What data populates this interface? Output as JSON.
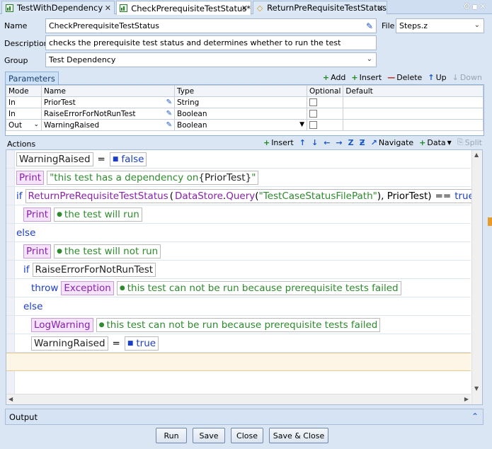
{
  "tabs": [
    {
      "label": "TestWithDependency",
      "icon": "test-icon"
    },
    {
      "label": "CheckPrerequisiteTestStatus*",
      "icon": "test-icon"
    },
    {
      "label": "ReturnPreRequisiteTestStatus",
      "icon": "function-icon"
    }
  ],
  "form": {
    "name_label": "Name",
    "name_value": "CheckPrerequisiteTestStatus",
    "file_label": "File",
    "file_value": "Steps.z",
    "desc_label": "Description",
    "desc_value": "checks the prerequisite test status and determines whether to run the test",
    "group_label": "Group",
    "group_value": "Test Dependency"
  },
  "params": {
    "tab_label": "Parameters",
    "toolbar": {
      "add": "Add",
      "insert": "Insert",
      "delete": "Delete",
      "up": "Up",
      "down": "Down"
    },
    "columns": [
      "Mode",
      "Name",
      "Type",
      "Optional",
      "Default"
    ],
    "rows": [
      {
        "mode": "In",
        "name": "PriorTest",
        "type": "String"
      },
      {
        "mode": "In",
        "name": "RaiseErrorForNotRunTest",
        "type": "Boolean"
      },
      {
        "mode": "Out",
        "name": "WarningRaised",
        "type": "Boolean"
      }
    ]
  },
  "actions": {
    "label": "Actions",
    "toolbar": {
      "insert": "Insert",
      "navigate": "Navigate",
      "data": "Data",
      "split": "Split"
    },
    "lines": {
      "l1_var": "WarningRaised",
      "l1_eq": "=",
      "l1_val": "false",
      "l2_fn": "Print",
      "l2_str_a": "\"this test has a dependency on ",
      "l2_var": "PriorTest",
      "l2_str_b": "\"",
      "l3_kw": "if",
      "l3_fn": "ReturnPreRequisiteTestStatus",
      "l3_open": "(",
      "l3_ds": "DataStore",
      "l3_dot": ".",
      "l3_query": "Query",
      "l3_paren": "(",
      "l3_str": "\"TestCaseStatusFilePath\"",
      "l3_rest": "), PriorTest)",
      "l3_op": "==",
      "l3_true": "true",
      "l4_fn": "Print",
      "l4_str": "the test will run",
      "l5_kw": "else",
      "l6_fn": "Print",
      "l6_str": "the test will not run",
      "l7_kw": "if",
      "l7_var": "RaiseErrorForNotRunTest",
      "l8_kw": "throw",
      "l8_fn": "Exception",
      "l8_str": "this test can not be run because prerequisite tests failed",
      "l9_kw": "else",
      "l10_fn": "LogWarning",
      "l10_str": "this test can not be run because prerequisite tests failed",
      "l11_var": "WarningRaised",
      "l11_eq": "=",
      "l11_val": "true"
    }
  },
  "output": {
    "label": "Output"
  },
  "buttons": {
    "run": "Run",
    "save": "Save",
    "close": "Close",
    "save_close": "Save & Close"
  }
}
